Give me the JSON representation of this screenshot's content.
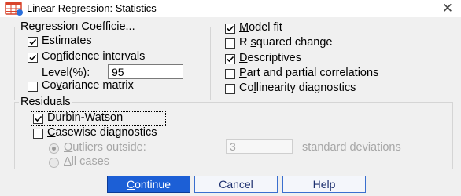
{
  "window": {
    "title": "Linear Regression: Statistics",
    "close_glyph": "✕"
  },
  "regression_coefficients": {
    "legend": "Regression Coefficie...",
    "estimates": {
      "label_pre": "",
      "label_u": "E",
      "label_post": "stimates",
      "checked": true
    },
    "confidence_intervals": {
      "label_pre": "Co",
      "label_u": "n",
      "label_post": "fidence intervals",
      "checked": true
    },
    "level_label": "Level(%):",
    "level_value": "95",
    "covariance_matrix": {
      "label_pre": "Co",
      "label_u": "v",
      "label_post": "ariance matrix",
      "checked": false
    }
  },
  "right_options": {
    "model_fit": {
      "label_pre": "",
      "label_u": "M",
      "label_post": "odel fit",
      "checked": true
    },
    "r_squared_change": {
      "label_pre": "R ",
      "label_u": "s",
      "label_post": "quared change",
      "checked": false
    },
    "descriptives": {
      "label_pre": "",
      "label_u": "D",
      "label_post": "escriptives",
      "checked": true
    },
    "part_partial": {
      "label_pre": "",
      "label_u": "P",
      "label_post": "art and partial correlations",
      "checked": false
    },
    "collinearity": {
      "label_pre": "Co",
      "label_u": "l",
      "label_post": "linearity diagnostics",
      "checked": false
    }
  },
  "residuals": {
    "legend": "Residuals",
    "durbin_watson": {
      "label_pre": "D",
      "label_u": "u",
      "label_post": "rbin-Watson",
      "checked": true
    },
    "casewise": {
      "label_pre": "",
      "label_u": "C",
      "label_post": "asewise diagnostics",
      "checked": false
    },
    "outliers": {
      "label_pre": "",
      "label_u": "O",
      "label_post": "utliers outside:",
      "selected": true
    },
    "outliers_value": "3",
    "std_dev_label": "standard deviations",
    "all_cases": {
      "label_pre": "",
      "label_u": "A",
      "label_post": "ll cases",
      "selected": false
    }
  },
  "buttons": {
    "continue": {
      "label_pre": "",
      "label_u": "C",
      "label_post": "ontinue"
    },
    "cancel": "Cancel",
    "help": "Help"
  },
  "colors": {
    "primary_button": "#1c5fd6",
    "button_border": "#3a6fcf",
    "app_icon_red": "#d9442b",
    "app_icon_blue": "#2a6fdb"
  },
  "icons": {
    "app": "spss-table-icon",
    "close": "close-icon",
    "check": "check-icon"
  }
}
